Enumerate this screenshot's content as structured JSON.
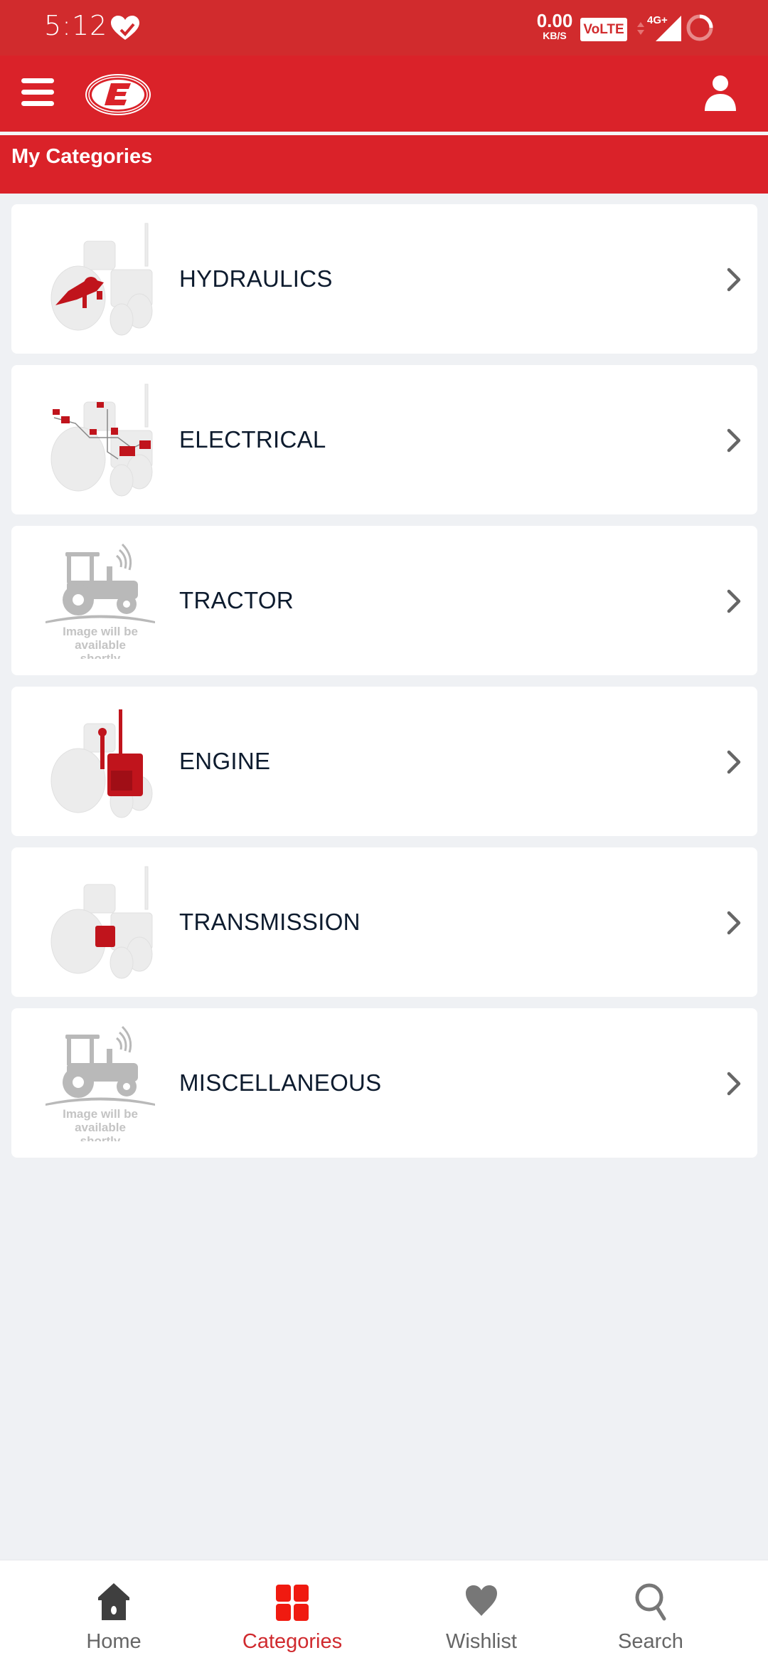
{
  "status_bar": {
    "time": "5:12",
    "net_speed_value": "0.00",
    "net_speed_unit": "KB/S",
    "volte": "VoLTE",
    "network": "4G+",
    "icons": [
      "health-heart-check-icon",
      "volte-icon",
      "data-arrows-icon",
      "signal-icon",
      "battery-ring-icon"
    ]
  },
  "app_bar": {
    "menu_icon": "hamburger-menu-icon",
    "logo": "brand-e-logo",
    "profile_icon": "user-profile-icon",
    "color": "#da2229"
  },
  "page": {
    "title": "My Categories"
  },
  "categories": [
    {
      "label": "HYDRAULICS",
      "image": "tractor-hydraulics-highlight"
    },
    {
      "label": "ELECTRICAL",
      "image": "tractor-electrical-highlight"
    },
    {
      "label": "TRACTOR",
      "image": "placeholder",
      "placeholder_text": "Image will be available shortly"
    },
    {
      "label": "ENGINE",
      "image": "tractor-engine-highlight"
    },
    {
      "label": "TRANSMISSION",
      "image": "tractor-transmission-highlight"
    },
    {
      "label": "MISCELLANEOUS",
      "image": "placeholder",
      "placeholder_text": "Image will be available shortly"
    }
  ],
  "placeholder": {
    "line1": "Image will be",
    "line2": "available",
    "line3": "shortly"
  },
  "bottom_nav": {
    "items": [
      {
        "label": "Home",
        "icon": "home-icon",
        "active": false
      },
      {
        "label": "Categories",
        "icon": "grid-icon",
        "active": true
      },
      {
        "label": "Wishlist",
        "icon": "heart-icon",
        "active": false
      },
      {
        "label": "Search",
        "icon": "search-icon",
        "active": false
      }
    ],
    "active_color": "#d02a2e",
    "inactive_color": "#666666"
  }
}
